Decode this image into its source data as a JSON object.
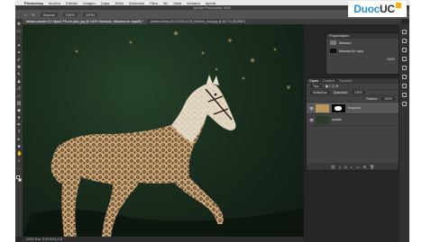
{
  "menubar": {
    "apple": "",
    "items": [
      "Photoshop",
      "Archivo",
      "Edición",
      "Imagen",
      "Capa",
      "Texto",
      "Selección",
      "Filtro",
      "3D",
      "Vista",
      "Ventana",
      "Ayuda"
    ]
  },
  "window": {
    "title": "Adobe Photoshop 2020"
  },
  "options": {
    "mode": "Normal",
    "opacity": "100%",
    "flow": "100%"
  },
  "tabs": [
    {
      "label": "tabaco-caballo-*(C:Mya/1.PS-sin.psb), jpg @ 100% Saturado, Máscara de capa/8) *",
      "active": true
    },
    {
      "label": "pexels-lobato-00-07020-14-Hl_BmHnb_ecor.jpg @ 66,7% (RGB/8*)",
      "active": false
    }
  ],
  "status": {
    "text": "100%   Doc: 5,93 M/11,4 M"
  },
  "history": {
    "title": "Propiedades",
    "rows": [
      "Máscara",
      "Máscara de capa"
    ],
    "value": "100%"
  },
  "layers": {
    "tabs": [
      "Capas",
      "Canales",
      "Trazados"
    ],
    "filter": "Tipo",
    "blend": "Multiplicar",
    "opacity_label": "Opacidad:",
    "opacity": "100%",
    "fill_label": "Relleno:",
    "fill": "100%",
    "items": [
      {
        "name": "leopardo",
        "selected": true
      },
      {
        "name": "caballo",
        "selected": false
      }
    ]
  },
  "brand": {
    "text_a": "Duoc",
    "text_b": "UC",
    "color_a": "#2f8fd6",
    "color_b": "#2d2d2d",
    "accent": "#f2b200"
  },
  "colors": {
    "bg": "#262626",
    "panel": "#424242"
  }
}
